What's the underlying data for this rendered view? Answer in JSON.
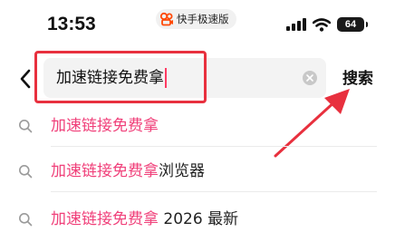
{
  "status_bar": {
    "time": "13:53",
    "app_pill_label": "快手极速版",
    "battery_level": "64"
  },
  "search": {
    "query": "加速链接免费拿",
    "submit_label": "搜索"
  },
  "suggestions": [
    {
      "match": "加速链接免费拿",
      "rest": ""
    },
    {
      "match": "加速链接免费拿",
      "rest": "浏览器"
    },
    {
      "match": "加速链接免费拿",
      "rest": " 2026 最新"
    }
  ],
  "colors": {
    "highlight_match": "#f0407a",
    "annotation_red": "#e8303e",
    "caret": "#ff3b62"
  },
  "icons": {
    "back": "chevron-left-icon",
    "clear": "clear-x-icon",
    "suggestion": "search-icon",
    "signal": "cellular-signal-icon",
    "wifi": "wifi-icon",
    "battery": "battery-icon"
  }
}
